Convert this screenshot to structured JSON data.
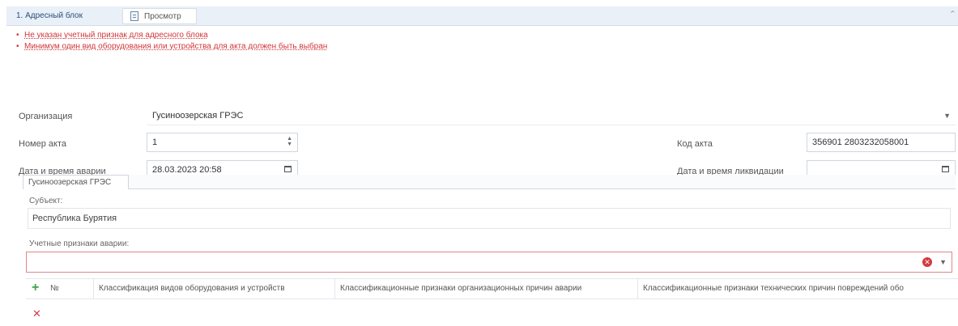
{
  "header": {
    "title": "1. Адресный блок",
    "view_button_label": "Просмотр"
  },
  "errors": [
    "Не указан учетный признак для адресного блока",
    "Минимум один вид оборудования или устройства для акта должен быть выбран"
  ],
  "form": {
    "organization": {
      "label": "Организация",
      "value": "Гусиноозерская ГРЭС"
    },
    "act_number": {
      "label": "Номер акта",
      "value": "1"
    },
    "act_code": {
      "label": "Код акта",
      "value": "356901 2803232058001"
    },
    "accident_datetime": {
      "label": "Дата и время аварии",
      "value": "28.03.2023 20:58"
    },
    "liquidation_datetime": {
      "label": "Дата и время ликвидации",
      "value": ""
    }
  },
  "tabs": [
    {
      "label": "Гусиноозерская ГРЭС"
    }
  ],
  "subject": {
    "label": "Субъект:",
    "value": "Республика Бурятия"
  },
  "accident_signs": {
    "label": "Учетные признаки аварии:",
    "value": ""
  },
  "grid": {
    "columns": [
      "№",
      "Классификация видов оборудования и устройств",
      "Классификационные признаки организационных причин аварии",
      "Классификационные признаки технических причин повреждений обо"
    ]
  },
  "colors": {
    "error": "#d0363b",
    "header_bg": "#e9f0f8",
    "add": "#3da34a"
  },
  "icons": [
    "document-icon",
    "chevron-up-icon",
    "chevron-down-icon",
    "spinner-icon",
    "calendar-icon",
    "clear-icon",
    "plus-icon",
    "delete-icon"
  ]
}
